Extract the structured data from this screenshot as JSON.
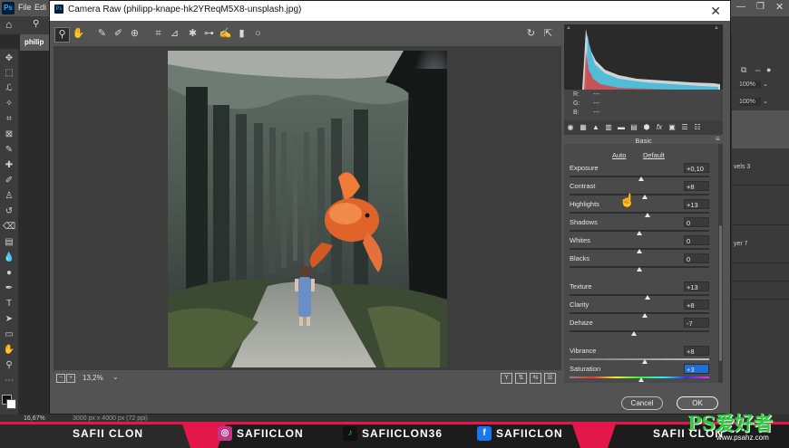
{
  "ps": {
    "logo": "Ps",
    "menu": [
      "File",
      "Edi"
    ],
    "tab_title": "philip",
    "zoom_status": "16,67%",
    "status_doc": "3000 px x 4000 px (72 ppi)",
    "right_panel": {
      "opacity_1": "100%",
      "opacity_2": "100%",
      "layer_a": "vels 3",
      "layer_b": "yer 7"
    }
  },
  "camera_raw": {
    "title": "Camera Raw (philipp-knape-hk2YReqM5X8-unsplash.jpg)",
    "zoom": "13,2%",
    "rgb": {
      "r_label": "R:",
      "r": "---",
      "g_label": "G:",
      "g": "---",
      "b_label": "B:",
      "b": "---"
    },
    "panel_title": "Basic",
    "auto_label": "Auto",
    "default_label": "Default",
    "sliders": [
      {
        "label": "Exposure",
        "value": "+0,10",
        "pos": 0.51
      },
      {
        "label": "Contrast",
        "value": "+8",
        "pos": 0.54
      },
      {
        "label": "Highlights",
        "value": "+13",
        "pos": 0.56
      },
      {
        "label": "Shadows",
        "value": "0",
        "pos": 0.5
      },
      {
        "label": "Whites",
        "value": "0",
        "pos": 0.5
      },
      {
        "label": "Blacks",
        "value": "0",
        "pos": 0.5
      },
      {
        "label": "Texture",
        "value": "+13",
        "pos": 0.56
      },
      {
        "label": "Clarity",
        "value": "+8",
        "pos": 0.54
      },
      {
        "label": "Dehaze",
        "value": "-7",
        "pos": 0.46
      },
      {
        "label": "Vibrance",
        "value": "+8",
        "pos": 0.54
      },
      {
        "label": "Saturation",
        "value": "+3",
        "pos": 0.51
      }
    ],
    "cancel_label": "Cancel",
    "ok_label": "OK"
  },
  "banner": {
    "left_name": "SAFII CLON",
    "instagram": "SAFIICLON",
    "tiktok": "SAFIICLON36",
    "facebook": "SAFIICLON",
    "right_name": "SAFII CLON",
    "watermark": "PS爱好者",
    "watermark_url": "www.psahz.com"
  },
  "colors": {
    "accent": "#e4174a",
    "ps_blue": "#31a8ff",
    "instagram": "#c13584",
    "facebook": "#1877f2",
    "tiktok_green": "#2ecc40"
  }
}
